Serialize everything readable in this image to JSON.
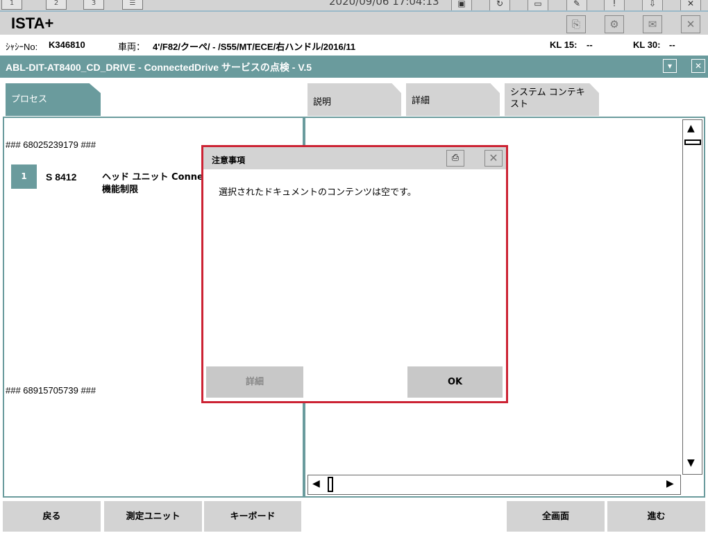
{
  "topbar": {
    "tabs": [
      "1",
      "2",
      "3"
    ],
    "datetime": "2020/09/06 17:04:13",
    "app_title": "ISTA+"
  },
  "vehicle": {
    "chassis_label": "ｼｬｼｰNo:",
    "chassis_no": "K346810",
    "vehicle_label": "車両：",
    "vehicle_desc": "4'/F82/クーペ/ - /S55/MT/ECE/右ハンドル/2016/11",
    "kl15_label": "KL 15:",
    "kl15_value": "--",
    "kl30_label": "KL 30:",
    "kl30_value": "--"
  },
  "procedure": {
    "title": "ABL-DIT-AT8400_CD_DRIVE - ConnectedDrive サービスの点検 - V.5"
  },
  "tabs": {
    "process": "プロセス",
    "description": "説明",
    "details": "詳細",
    "system_context": "システム コンテキスト"
  },
  "left_panel": {
    "hash_top": "### 68025239179 ###",
    "step_number": "1",
    "step_code": "S 8412",
    "step_desc_line1": "ヘッド ユニット Conne",
    "step_desc_line2": "機能制限",
    "hash_bottom": "### 68915705739 ###"
  },
  "modal": {
    "title": "注意事項",
    "message": "選択されたドキュメントのコンテンツは空です。",
    "details_button": "詳細",
    "ok_button": "OK"
  },
  "bottom_bar": {
    "back": "戻る",
    "measuring_unit": "測定ユニット",
    "keyboard": "キーボード",
    "fullscreen": "全画面",
    "next": "進む"
  },
  "colors": {
    "accent": "#6a9b9d",
    "modal_border": "#cc2233",
    "button_gray": "#d3d3d3"
  }
}
